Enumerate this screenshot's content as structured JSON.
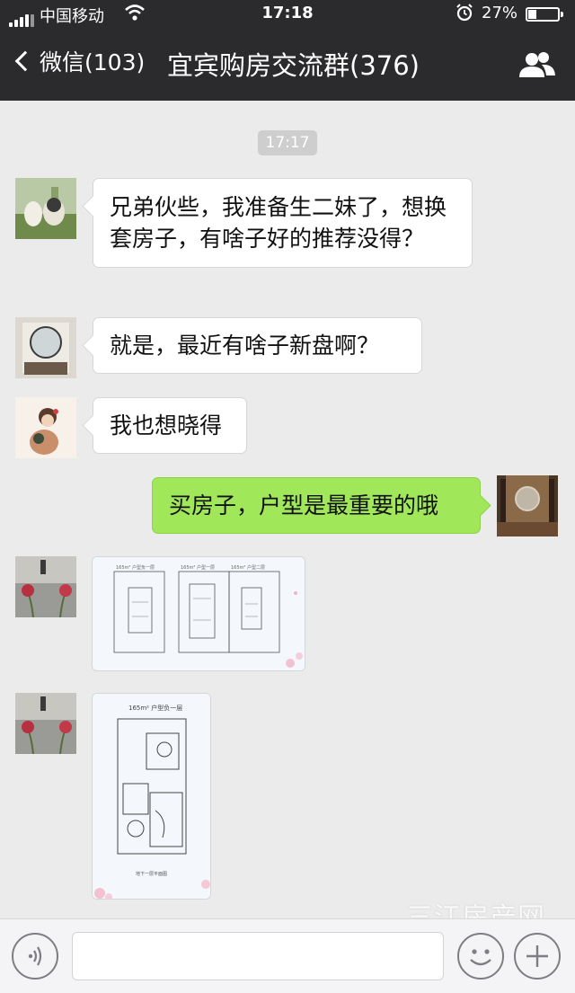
{
  "status_bar": {
    "carrier": "中国移动",
    "time": "17:18",
    "battery": "27%"
  },
  "nav": {
    "back_label": "微信(103)",
    "title": "宜宾购房交流群(376)"
  },
  "chat": {
    "timestamp": "17:17",
    "messages": [
      {
        "side": "left",
        "type": "text",
        "text": "兄弟伙些，我准备生二妹了，想换套房子，有啥子好的推荐没得？"
      },
      {
        "side": "left",
        "type": "text",
        "text": "就是，最近有啥子新盘啊？"
      },
      {
        "side": "left",
        "type": "text",
        "text": "我也想晓得"
      },
      {
        "side": "right",
        "type": "text",
        "text": "买房子，户型是最重要的哦"
      },
      {
        "side": "left",
        "type": "image",
        "image_captions": [
          "165m² 户型负一层",
          "165m² 户型一层",
          "165m² 户型二层"
        ]
      },
      {
        "side": "left",
        "type": "image",
        "image_captions": [
          "165m² 户型负一层",
          "地下一层平面图"
        ]
      }
    ]
  },
  "watermark": "三江房产网",
  "icons": {
    "back": "chevron-left-icon",
    "group": "group-members-icon",
    "voice": "voice-icon",
    "emoji": "emoji-icon",
    "plus": "plus-icon"
  }
}
